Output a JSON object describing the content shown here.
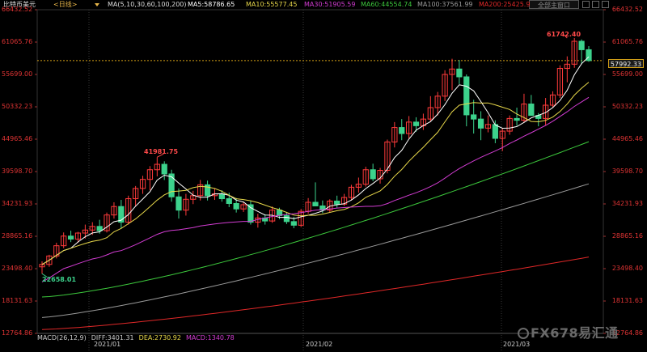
{
  "header": {
    "symbol": "比特币美元",
    "period": "<日线>",
    "ma_spec": "MA(5,10,30,60,100,200)",
    "ma_values": [
      {
        "label": "MA5:58786.65",
        "color": "#ffffff"
      },
      {
        "label": "MA10:55577.45",
        "color": "#e8d84a"
      },
      {
        "label": "MA30:51905.59",
        "color": "#d23cd2"
      },
      {
        "label": "MA60:44554.74",
        "color": "#3cc83c"
      },
      {
        "label": "MA100:37561.99",
        "color": "#9a9a9a"
      },
      {
        "label": "MA200:25425.9",
        "color": "#e02828"
      }
    ],
    "toggle_label": "全部主窗口"
  },
  "y_axis_labels": [
    "66432.52",
    "61065.76",
    "55699.00",
    "50332.23",
    "44965.46",
    "39598.70",
    "34231.93",
    "28865.16",
    "23498.40",
    "18131.63",
    "12764.86"
  ],
  "last_price": "57992.33",
  "x_axis_labels": [
    "2021/01",
    "2021/02",
    "2021/03"
  ],
  "annotations": {
    "high_1": "41981.75",
    "high_2": "61742.40",
    "low_1": "22658.01"
  },
  "macd": {
    "title": "MACD(26,12,9)",
    "dif": "DIFF:3401.31",
    "dea": "DEA:2730.92",
    "macd": "MACD:1340.78"
  },
  "watermark": "FX678易汇通",
  "colors": {
    "up": "#ff3b3b",
    "down": "#3cd28c",
    "axis_text": "#e03434",
    "grid": "#2a2a2a"
  },
  "chart_data": {
    "type": "candlestick",
    "title": "比特币美元 <日线>",
    "ylim": [
      12764.86,
      66432.52
    ],
    "x_labels": [
      "2021/01",
      "2021/02",
      "2021/03"
    ],
    "candles": [
      {
        "o": 23800,
        "h": 24700,
        "l": 22658,
        "c": 24200
      },
      {
        "o": 24200,
        "h": 25800,
        "l": 23800,
        "c": 25600
      },
      {
        "o": 25600,
        "h": 27800,
        "l": 25200,
        "c": 27300
      },
      {
        "o": 27300,
        "h": 29500,
        "l": 26900,
        "c": 28900
      },
      {
        "o": 28900,
        "h": 29800,
        "l": 27900,
        "c": 28400
      },
      {
        "o": 28400,
        "h": 29600,
        "l": 27800,
        "c": 29400
      },
      {
        "o": 29400,
        "h": 30800,
        "l": 28500,
        "c": 29900
      },
      {
        "o": 29900,
        "h": 31200,
        "l": 29100,
        "c": 30500
      },
      {
        "o": 30500,
        "h": 31600,
        "l": 29300,
        "c": 29800
      },
      {
        "o": 29800,
        "h": 32800,
        "l": 29500,
        "c": 32400
      },
      {
        "o": 32400,
        "h": 34500,
        "l": 31800,
        "c": 33800
      },
      {
        "o": 33800,
        "h": 34900,
        "l": 30200,
        "c": 31200
      },
      {
        "o": 31200,
        "h": 35600,
        "l": 30800,
        "c": 35100
      },
      {
        "o": 35100,
        "h": 37200,
        "l": 33800,
        "c": 36800
      },
      {
        "o": 36800,
        "h": 38900,
        "l": 35900,
        "c": 38300
      },
      {
        "o": 38300,
        "h": 40500,
        "l": 36500,
        "c": 39900
      },
      {
        "o": 39900,
        "h": 41982,
        "l": 38800,
        "c": 40800
      },
      {
        "o": 40800,
        "h": 41300,
        "l": 38200,
        "c": 39200
      },
      {
        "o": 39200,
        "h": 39900,
        "l": 34600,
        "c": 35400
      },
      {
        "o": 35400,
        "h": 36800,
        "l": 31800,
        "c": 33200
      },
      {
        "o": 33200,
        "h": 35900,
        "l": 32300,
        "c": 35000
      },
      {
        "o": 35000,
        "h": 36400,
        "l": 34200,
        "c": 35600
      },
      {
        "o": 35600,
        "h": 38200,
        "l": 34800,
        "c": 37400
      },
      {
        "o": 37400,
        "h": 38100,
        "l": 34800,
        "c": 35600
      },
      {
        "o": 35600,
        "h": 36800,
        "l": 34900,
        "c": 35900
      },
      {
        "o": 35900,
        "h": 36500,
        "l": 34600,
        "c": 35100
      },
      {
        "o": 35100,
        "h": 36100,
        "l": 33700,
        "c": 34300
      },
      {
        "o": 34300,
        "h": 35200,
        "l": 32800,
        "c": 33400
      },
      {
        "o": 33400,
        "h": 34500,
        "l": 32900,
        "c": 34100
      },
      {
        "o": 34100,
        "h": 34700,
        "l": 30800,
        "c": 31200
      },
      {
        "o": 31200,
        "h": 32600,
        "l": 30300,
        "c": 31900
      },
      {
        "o": 31900,
        "h": 32500,
        "l": 30800,
        "c": 31400
      },
      {
        "o": 31400,
        "h": 33800,
        "l": 31100,
        "c": 33200
      },
      {
        "o": 33200,
        "h": 33600,
        "l": 31700,
        "c": 32300
      },
      {
        "o": 32300,
        "h": 32900,
        "l": 30900,
        "c": 31300
      },
      {
        "o": 31300,
        "h": 32100,
        "l": 30200,
        "c": 30700
      },
      {
        "o": 30700,
        "h": 33400,
        "l": 30400,
        "c": 33000
      },
      {
        "o": 33000,
        "h": 35200,
        "l": 32600,
        "c": 34500
      },
      {
        "o": 34500,
        "h": 37800,
        "l": 33900,
        "c": 33900
      },
      {
        "o": 33900,
        "h": 34800,
        "l": 32700,
        "c": 33200
      },
      {
        "o": 33200,
        "h": 35000,
        "l": 32800,
        "c": 34700
      },
      {
        "o": 34700,
        "h": 35600,
        "l": 33600,
        "c": 34200
      },
      {
        "o": 34200,
        "h": 35900,
        "l": 33900,
        "c": 35300
      },
      {
        "o": 35300,
        "h": 37400,
        "l": 34800,
        "c": 37000
      },
      {
        "o": 37000,
        "h": 38600,
        "l": 36100,
        "c": 37500
      },
      {
        "o": 37500,
        "h": 40400,
        "l": 37100,
        "c": 39900
      },
      {
        "o": 39900,
        "h": 40900,
        "l": 38000,
        "c": 38400
      },
      {
        "o": 38400,
        "h": 40200,
        "l": 37600,
        "c": 39800
      },
      {
        "o": 39800,
        "h": 44900,
        "l": 39300,
        "c": 44500
      },
      {
        "o": 44500,
        "h": 47800,
        "l": 43600,
        "c": 46900
      },
      {
        "o": 46900,
        "h": 48300,
        "l": 44800,
        "c": 45900
      },
      {
        "o": 45900,
        "h": 48800,
        "l": 45100,
        "c": 47800
      },
      {
        "o": 47800,
        "h": 48600,
        "l": 46200,
        "c": 47200
      },
      {
        "o": 47200,
        "h": 49200,
        "l": 46500,
        "c": 48300
      },
      {
        "o": 48300,
        "h": 52100,
        "l": 47900,
        "c": 50200
      },
      {
        "o": 50200,
        "h": 52800,
        "l": 48900,
        "c": 52100
      },
      {
        "o": 52100,
        "h": 56400,
        "l": 51300,
        "c": 55700
      },
      {
        "o": 55700,
        "h": 58300,
        "l": 53100,
        "c": 56600
      },
      {
        "o": 56600,
        "h": 58100,
        "l": 54100,
        "c": 55300
      },
      {
        "o": 55300,
        "h": 55700,
        "l": 47100,
        "c": 49000
      },
      {
        "o": 49000,
        "h": 51500,
        "l": 45900,
        "c": 48300
      },
      {
        "o": 48300,
        "h": 49600,
        "l": 44800,
        "c": 46800
      },
      {
        "o": 46800,
        "h": 48900,
        "l": 46100,
        "c": 47400
      },
      {
        "o": 47400,
        "h": 48100,
        "l": 44300,
        "c": 45100
      },
      {
        "o": 45100,
        "h": 46800,
        "l": 43000,
        "c": 46300
      },
      {
        "o": 46300,
        "h": 48900,
        "l": 45700,
        "c": 48400
      },
      {
        "o": 48400,
        "h": 50200,
        "l": 47200,
        "c": 48100
      },
      {
        "o": 48100,
        "h": 52500,
        "l": 47700,
        "c": 50800
      },
      {
        "o": 50800,
        "h": 52300,
        "l": 49700,
        "c": 48900
      },
      {
        "o": 48900,
        "h": 49300,
        "l": 47100,
        "c": 48400
      },
      {
        "o": 48400,
        "h": 51800,
        "l": 47300,
        "c": 50600
      },
      {
        "o": 50600,
        "h": 52900,
        "l": 50200,
        "c": 52300
      },
      {
        "o": 52300,
        "h": 57200,
        "l": 51800,
        "c": 56700
      },
      {
        "o": 56700,
        "h": 58700,
        "l": 54400,
        "c": 57400
      },
      {
        "o": 57400,
        "h": 61742,
        "l": 56800,
        "c": 61200
      },
      {
        "o": 61200,
        "h": 61500,
        "l": 57400,
        "c": 59800
      },
      {
        "o": 59800,
        "h": 60400,
        "l": 57800,
        "c": 57992
      }
    ],
    "series": [
      {
        "name": "MA5",
        "values_last": 58786.65
      },
      {
        "name": "MA10",
        "values_last": 55577.45
      },
      {
        "name": "MA30",
        "values_last": 51905.59
      },
      {
        "name": "MA60",
        "values_last": 44554.74
      },
      {
        "name": "MA100",
        "values_last": 37561.99
      },
      {
        "name": "MA200",
        "values_last": 25425.9
      }
    ]
  }
}
